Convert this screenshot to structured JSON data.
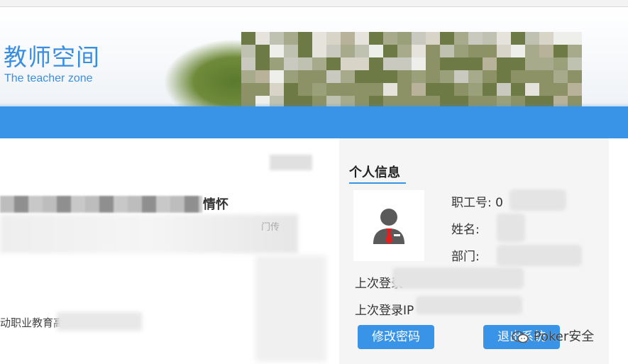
{
  "header": {
    "title": "教师空间",
    "subtitle": "The teacher zone"
  },
  "article": {
    "title_tail": "情怀",
    "meta_fragment": "门传",
    "line_fragment": "动职业教育高"
  },
  "profile": {
    "heading": "个人信息",
    "staff_id_label": "职工号:",
    "staff_id_value": "0",
    "name_label": "姓名:",
    "dept_label": "部门:",
    "last_login_label": "上次登录",
    "last_login_ip_label": "上次登录IP",
    "change_password_button": "修改密码",
    "logout_button": "退出系统"
  },
  "watermark": {
    "text": "Poker安全"
  },
  "colors": {
    "accent": "#3993e6",
    "brand_text": "#3a8ee0"
  }
}
